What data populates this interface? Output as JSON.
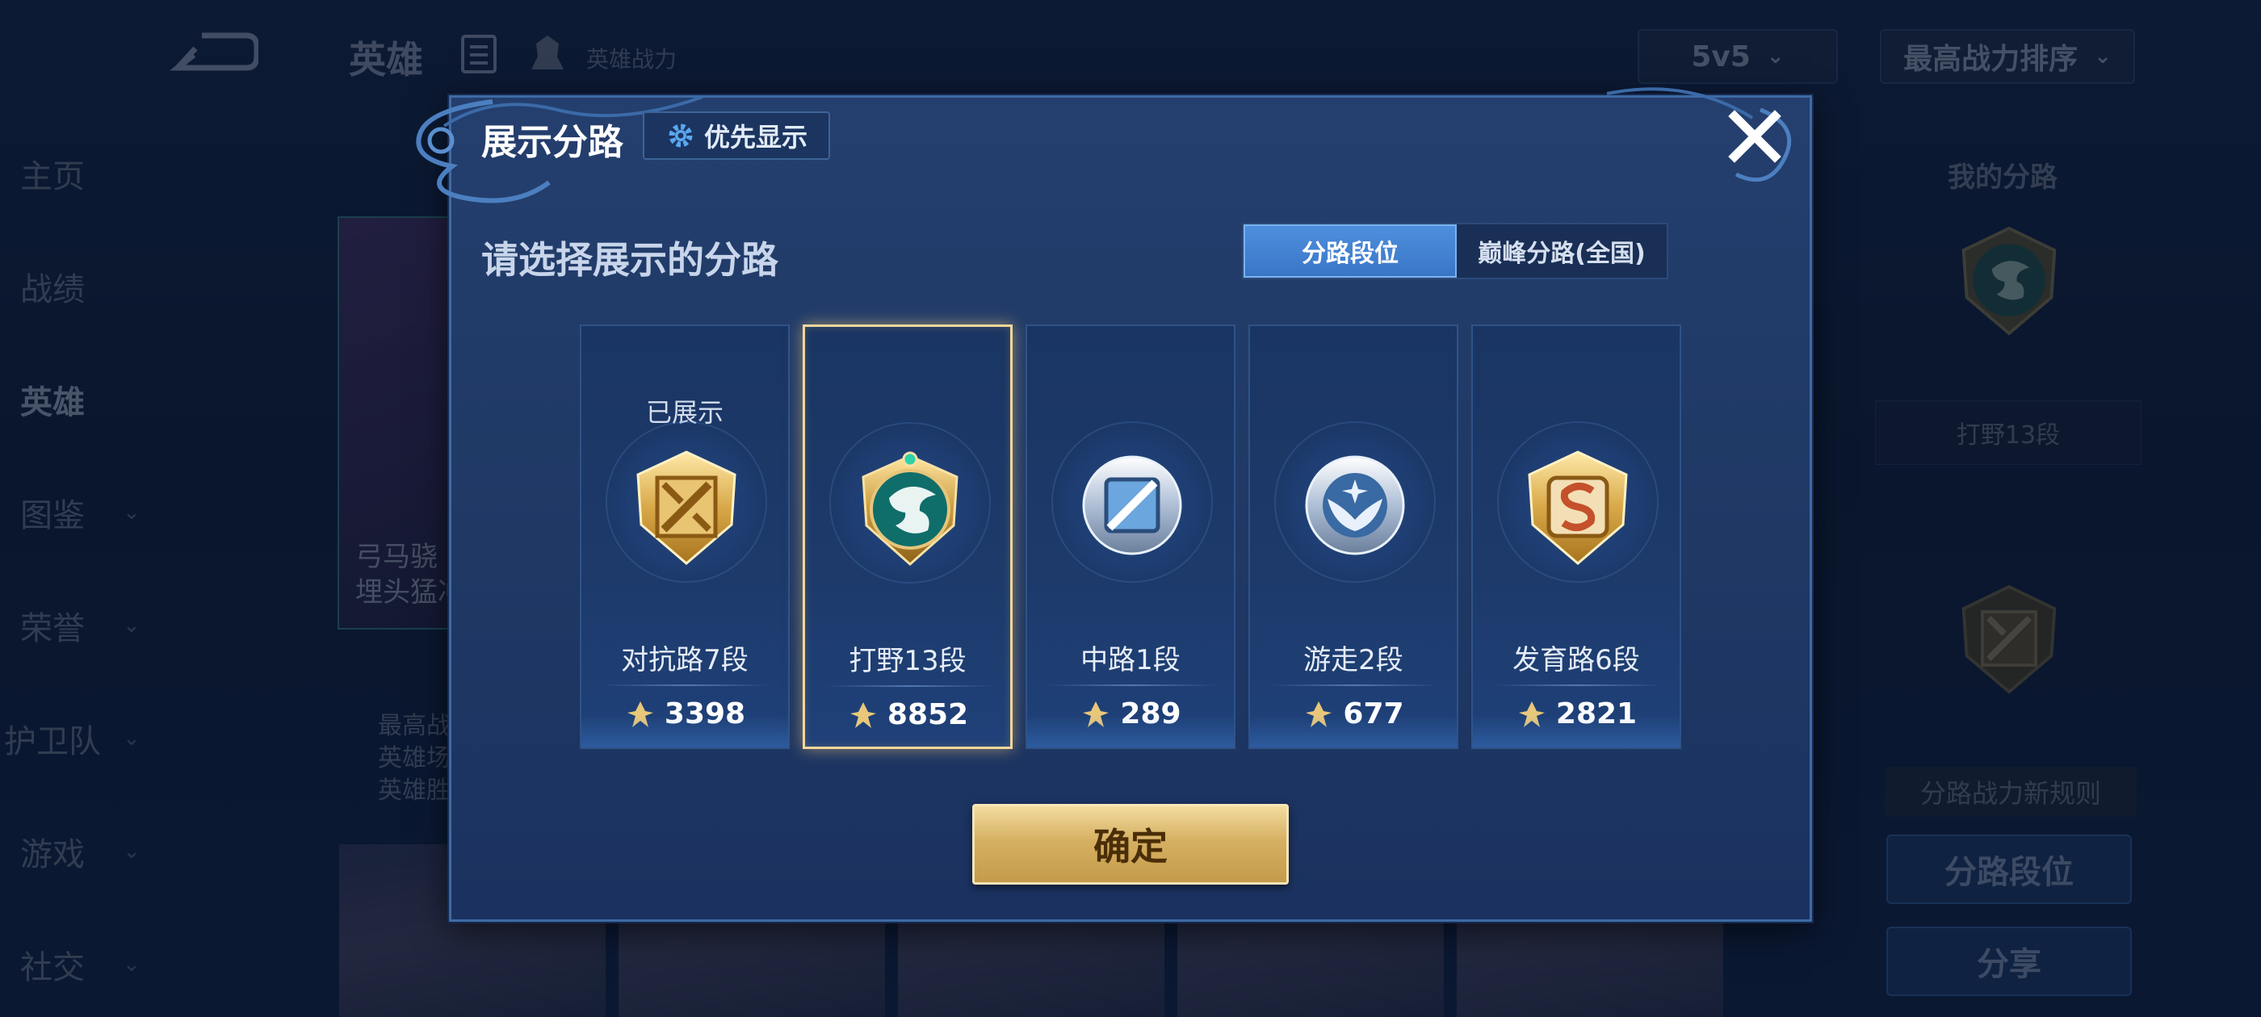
{
  "background": {
    "top_title": "英雄",
    "power_text": "英雄战力",
    "mode_select": "5v5",
    "sort_select": "最高战力排序",
    "nav": [
      {
        "label": "主页",
        "chevron": false
      },
      {
        "label": "战绩",
        "chevron": false
      },
      {
        "label": "英雄",
        "chevron": false,
        "active": true
      },
      {
        "label": "图鉴",
        "chevron": true
      },
      {
        "label": "荣誉",
        "chevron": true
      },
      {
        "label": "护卫队",
        "chevron": true
      },
      {
        "label": "游戏",
        "chevron": true
      },
      {
        "label": "社交",
        "chevron": true
      }
    ],
    "hero_card_line1": "弓马骁",
    "hero_card_line2": "埋头猛冲",
    "hero_stats": [
      "最高战",
      "英雄场",
      "英雄胜"
    ],
    "right_panel": {
      "title": "我的分路",
      "label": "打野13段",
      "rule": "分路战力新规则",
      "btn1": "分路段位",
      "btn2": "分享"
    }
  },
  "modal": {
    "title": "展示分路",
    "priority_button": "优先显示",
    "subtitle": "请选择展示的分路",
    "toggle": {
      "options": [
        "分路段位",
        "巅峰分路(全国)"
      ],
      "active_index": 0
    },
    "lanes": [
      {
        "name": "对抗路7段",
        "power": "3398",
        "shown_label": "已展示",
        "badge": "clash-lane-badge-icon",
        "selected": false
      },
      {
        "name": "打野13段",
        "power": "8852",
        "shown_label": "",
        "badge": "jungle-dragon-badge-icon",
        "selected": true
      },
      {
        "name": "中路1段",
        "power": "289",
        "shown_label": "",
        "badge": "mid-lane-badge-icon",
        "selected": false
      },
      {
        "name": "游走2段",
        "power": "677",
        "shown_label": "",
        "badge": "roam-wings-badge-icon",
        "selected": false
      },
      {
        "name": "发育路6段",
        "power": "2821",
        "shown_label": "",
        "badge": "farm-lane-badge-icon",
        "selected": false
      }
    ],
    "confirm": "确定"
  },
  "colors": {
    "accent_gold": "#d6b062",
    "selected_border": "#f2d79a",
    "toggle_active": "#4e8fdd",
    "modal_bg": "#1f3864"
  }
}
